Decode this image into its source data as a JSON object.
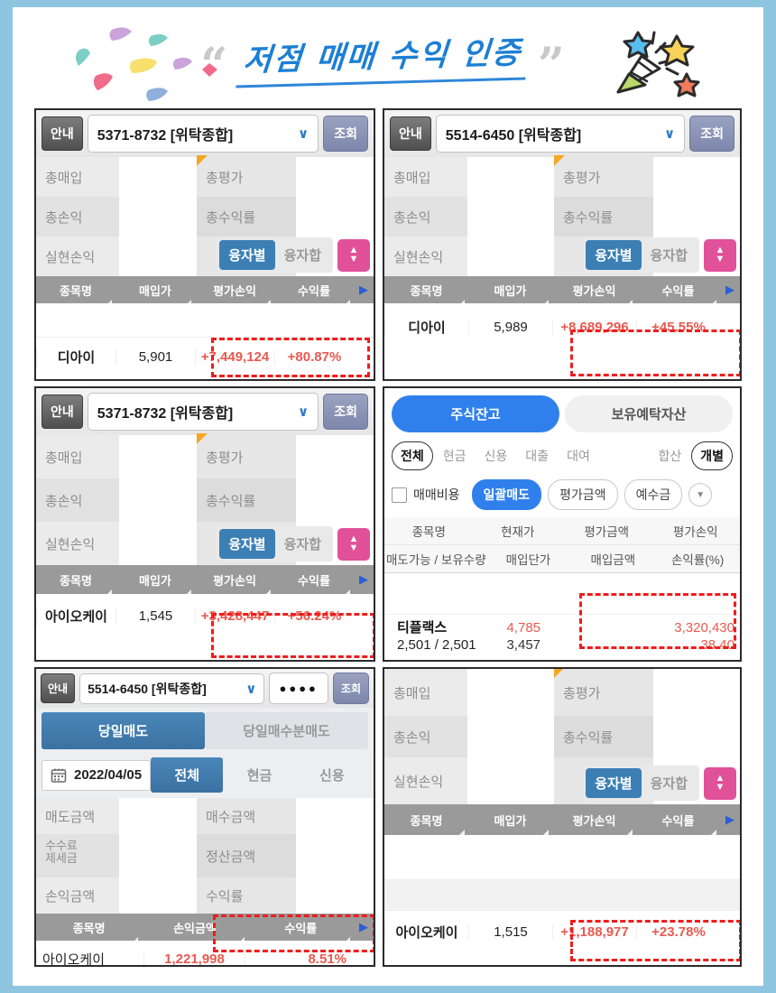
{
  "page": {
    "border_color": "#8ec5e0",
    "title": "저점 매매 수익 인증",
    "quote_open": "“",
    "quote_close": "”",
    "popper_icon": "party-popper-icon",
    "confetti_icon": "confetti-icon"
  },
  "common": {
    "guide_label": "안내",
    "query_label": "조회",
    "chevron": "∨",
    "corner_flag_color": "#f5a623",
    "accent_blue": "#3b7fb5",
    "accent_pink": "#e0519a",
    "header_gray": "#9a9a9a",
    "highlight_red": "#ee1d1d",
    "profit_red": "#e8594f",
    "summary_labels": {
      "total_buy": "총매입",
      "total_eval": "총평가",
      "total_pl": "총손익",
      "total_rate": "총수익률",
      "realized_pl": "실현손익"
    },
    "loan_toggle": {
      "on": "융자별",
      "off": "융자합"
    },
    "updown_icon": "up-down-arrow-icon",
    "table_headers": [
      "종목명",
      "매입가",
      "평가손익",
      "수익률"
    ],
    "next_arrow": "▶"
  },
  "cards": [
    {
      "id": "card-1",
      "type": "holdings",
      "account": "5371-8732 [위탁종합]",
      "row": {
        "name": "디아이",
        "buy_price": "5,901",
        "eval_pl": "+7,449,124",
        "rate": "+80.87%"
      }
    },
    {
      "id": "card-2",
      "type": "holdings",
      "account": "5514-6450 [위탁종합]",
      "row": {
        "name": "디아이",
        "buy_price": "5,989",
        "eval_pl": "+8,689,296",
        "rate": "+45.55%"
      }
    },
    {
      "id": "card-3",
      "type": "holdings",
      "account": "5371-8732 [위탁종합]",
      "row": {
        "name": "아이오케이",
        "buy_price": "1,545",
        "eval_pl": "+3,428,447",
        "rate": "+56.24%"
      }
    },
    {
      "id": "card-4",
      "type": "stock-balance",
      "tabs": [
        {
          "label": "주식잔고",
          "active": true
        },
        {
          "label": "보유예탁자산",
          "active": false
        }
      ],
      "chips_left": [
        {
          "label": "전체",
          "active": true
        },
        {
          "label": "현금",
          "active": false
        },
        {
          "label": "신용",
          "active": false
        },
        {
          "label": "대출",
          "active": false
        },
        {
          "label": "대여",
          "active": false
        }
      ],
      "chips_right": [
        {
          "label": "합산",
          "active": false
        },
        {
          "label": "개별",
          "active": true
        }
      ],
      "checkbox_label": "매매비용",
      "option_buttons": [
        {
          "label": "일괄매도",
          "active": true
        },
        {
          "label": "평가금액",
          "active": false
        },
        {
          "label": "예수금",
          "active": false
        }
      ],
      "more_icon": "chevron-down-icon",
      "header_row1": [
        "종목명",
        "현재가",
        "평가금액",
        "평가손익"
      ],
      "header_row2": [
        "매도가능 / 보유수량",
        "매입단가",
        "매입금액",
        "손익률(%)"
      ],
      "row": {
        "name": "티플랙스",
        "qty": "2,501 / 2,501",
        "current_price": "4,785",
        "avg_price": "3,457",
        "eval_amount": "",
        "buy_amount": "",
        "eval_pl": "3,320,430",
        "pl_rate": "38.40"
      }
    },
    {
      "id": "card-5",
      "type": "daily-sell",
      "account": "5514-6450 [위탁종합]",
      "password_mask": "●●●●",
      "segments": [
        {
          "label": "당일매도",
          "active": true
        },
        {
          "label": "당일매수분매도",
          "active": false
        }
      ],
      "date": "2022/04/05",
      "calendar_icon": "calendar-icon",
      "date_segments": [
        {
          "label": "전체",
          "active": true
        },
        {
          "label": "현금",
          "active": false
        },
        {
          "label": "신용",
          "active": false
        }
      ],
      "summary_labels": {
        "sell_amount": "매도금액",
        "buy_amount": "매수금액",
        "fee_tax": "수수료\n제세금",
        "settle_amount": "정산금액",
        "pl_amount": "손익금액",
        "rate": "수익률"
      },
      "table_headers": [
        "종목명",
        "손익금액",
        "수익률"
      ],
      "row": {
        "name": "아이오케이",
        "pl_amount": "1,221,998",
        "rate": "8.51%"
      }
    },
    {
      "id": "card-6",
      "type": "holdings-noheader",
      "row": {
        "name": "아이오케이",
        "buy_price": "1,515",
        "eval_pl": "+1,188,977",
        "rate": "+23.78%"
      }
    }
  ]
}
